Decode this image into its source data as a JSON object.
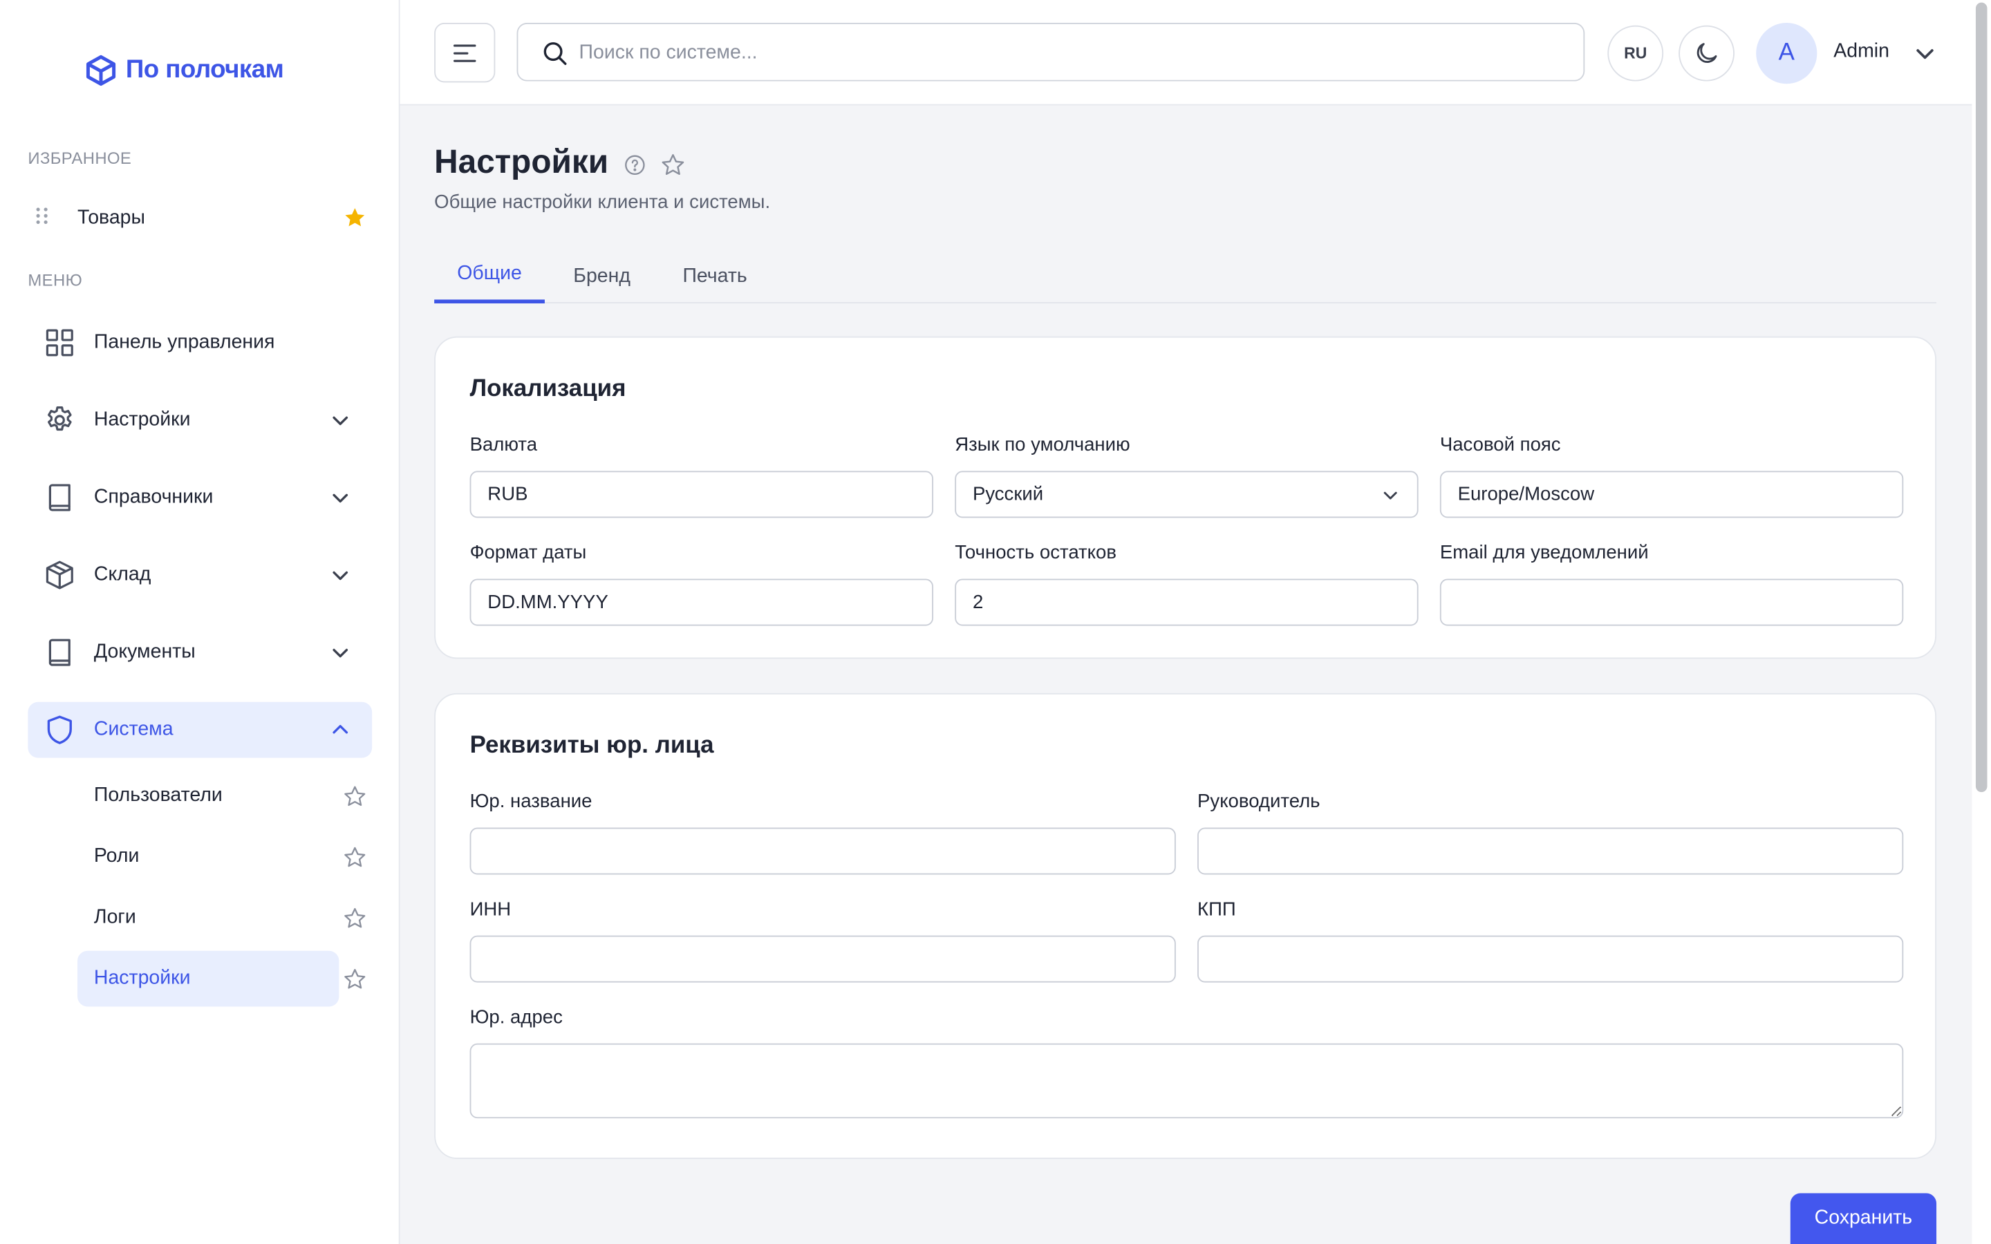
{
  "brand": {
    "name": "По полочкам",
    "color": "#3d55e6"
  },
  "sidebar": {
    "favorites_label": "ИЗБРАННОЕ",
    "favorites": [
      {
        "label": "Товары",
        "icon": "star-filled-icon",
        "star_color": "#f5b400"
      }
    ],
    "menu_label": "МЕНЮ",
    "items": [
      {
        "label": "Панель управления",
        "icon": "grid-icon"
      },
      {
        "label": "Настройки",
        "icon": "gear-icon"
      },
      {
        "label": "Справочники",
        "icon": "book-icon"
      },
      {
        "label": "Склад",
        "icon": "box-icon"
      },
      {
        "label": "Документы",
        "icon": "book-icon"
      },
      {
        "label": "Система",
        "icon": "shield-icon",
        "expanded": true,
        "active": true
      }
    ],
    "subitems": [
      {
        "label": "Пользователи"
      },
      {
        "label": "Роли"
      },
      {
        "label": "Логи"
      },
      {
        "label": "Настройки",
        "active": true
      }
    ]
  },
  "topbar": {
    "search_placeholder": "Поиск по системе...",
    "lang": "RU",
    "avatar_initial": "A",
    "username": "Admin"
  },
  "page": {
    "title": "Настройки",
    "subtitle": "Общие настройки клиента и системы.",
    "tabs": [
      {
        "label": "Общие",
        "active": true
      },
      {
        "label": "Бренд"
      },
      {
        "label": "Печать"
      }
    ]
  },
  "localization": {
    "title": "Локализация",
    "currency": {
      "label": "Валюта",
      "value": "RUB"
    },
    "language": {
      "label": "Язык по умолчанию",
      "value": "Русский"
    },
    "timezone": {
      "label": "Часовой пояс",
      "value": "Europe/Moscow"
    },
    "date_format": {
      "label": "Формат даты",
      "value": "DD.MM.YYYY"
    },
    "stock_precision": {
      "label": "Точность остатков",
      "value": "2"
    },
    "notify_email": {
      "label": "Email для уведомлений",
      "value": ""
    }
  },
  "legal": {
    "title": "Реквизиты юр. лица",
    "legal_name": {
      "label": "Юр. название",
      "value": ""
    },
    "director": {
      "label": "Руководитель",
      "value": ""
    },
    "inn": {
      "label": "ИНН",
      "value": ""
    },
    "kpp": {
      "label": "КПП",
      "value": ""
    },
    "address": {
      "label": "Юр. адрес",
      "value": ""
    }
  },
  "actions": {
    "save_label": "Сохранить",
    "save_color": "#4357ee"
  }
}
